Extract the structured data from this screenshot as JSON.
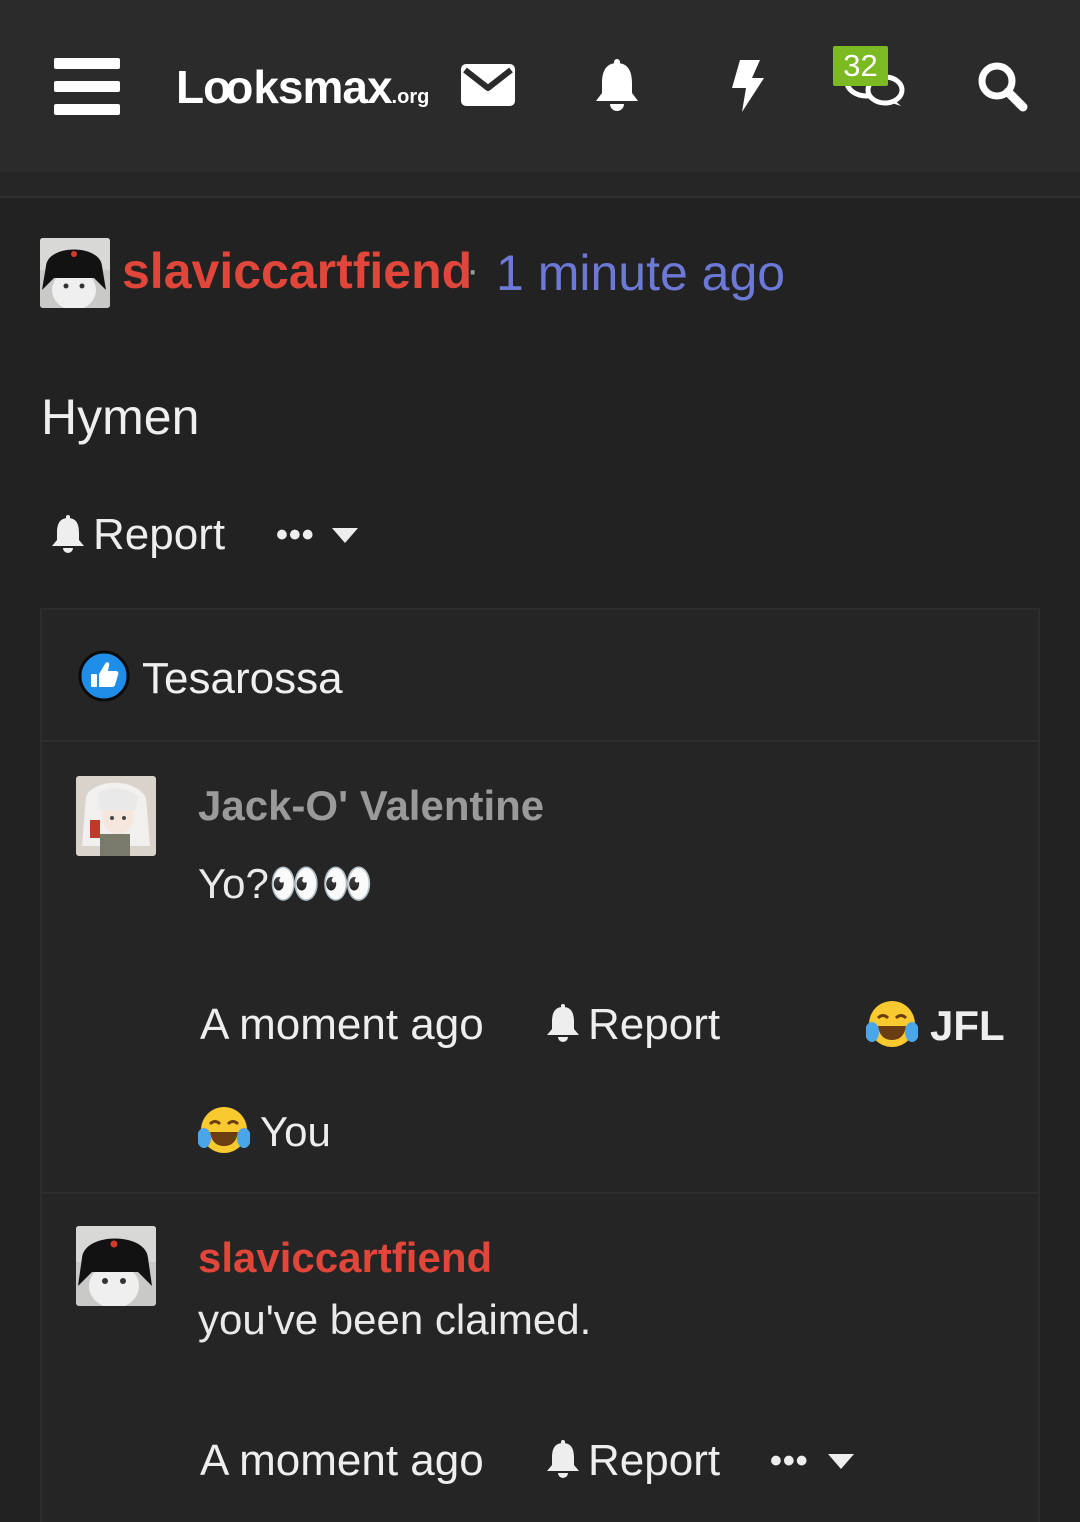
{
  "header": {
    "logo_main": "L",
    "logo_oo": "oo",
    "logo_rest": "ksmax",
    "logo_tld": ".org",
    "conversations_badge": "32",
    "icons": [
      "menu-icon",
      "envelope-icon",
      "bell-icon",
      "bolt-icon",
      "chat-bubbles-icon",
      "search-icon"
    ]
  },
  "post": {
    "username": "slaviccartfiend",
    "separator": "·",
    "time": "1 minute ago",
    "body": "Hymen",
    "report_label": "Report",
    "more_label": "•••"
  },
  "likes": {
    "icon": "thumbs-up-icon",
    "names": "Tesarossa"
  },
  "comments": [
    {
      "username": "Jack-O' Valentine",
      "text": "Yo?",
      "emoji": "👀👀",
      "time": "A moment ago",
      "report_label": "Report",
      "reaction_label": "JFL",
      "reaction_icon": "crying-laughing-icon",
      "reactors_label": "You"
    },
    {
      "username": "slaviccartfiend",
      "text": "you've been claimed.",
      "time": "A moment ago",
      "report_label": "Report",
      "more_label": "•••"
    }
  ],
  "colors": {
    "background": "#222222",
    "topbar": "#2b2b2b",
    "username_red": "#e0463a",
    "username_grey": "#9a9a9a",
    "time_blue": "#6c79d6",
    "badge_green": "#7cba23",
    "like_blue": "#1f8ee8"
  }
}
